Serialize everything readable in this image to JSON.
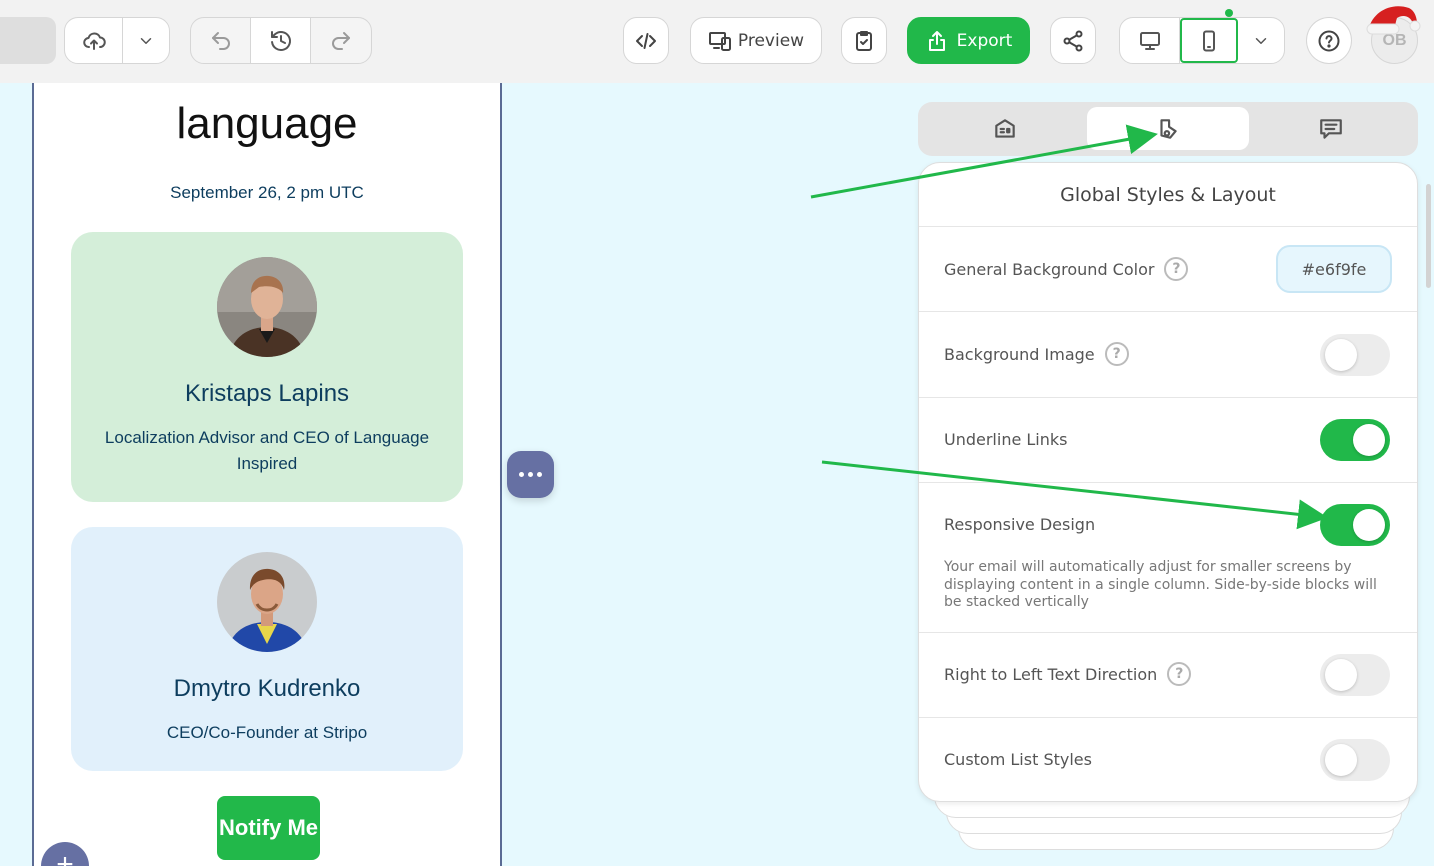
{
  "toolbar": {
    "preview_label": "Preview",
    "export_label": "Export",
    "avatar_initials": "OB",
    "accent_color": "#21b84a"
  },
  "email": {
    "heading": "language",
    "date": "September 26, 2 pm UTC",
    "speakers": [
      {
        "name": "Kristaps Lapins",
        "role": "Localization Advisor and CEO of Language Inspired"
      },
      {
        "name": "Dmytro Kudrenko",
        "role": "CEO/Co-Founder at Stripo"
      }
    ],
    "notify_label": "Notify Me",
    "add_symbol": "+"
  },
  "panel": {
    "title": "Global Styles & Layout",
    "rows": {
      "bg_color": {
        "label": "General Background Color",
        "value": "#e6f9fe"
      },
      "bg_image": {
        "label": "Background Image",
        "enabled": false
      },
      "underline": {
        "label": "Underline Links",
        "enabled": true
      },
      "responsive": {
        "label": "Responsive Design",
        "enabled": true,
        "description": "Your email will automatically adjust for smaller screens by displaying content in a single column. Side-by-side blocks will be stacked vertically"
      },
      "rtl": {
        "label": "Right to Left Text Direction",
        "enabled": false
      },
      "custom_list": {
        "label": "Custom List Styles",
        "enabled": false
      }
    },
    "help_symbol": "?"
  }
}
